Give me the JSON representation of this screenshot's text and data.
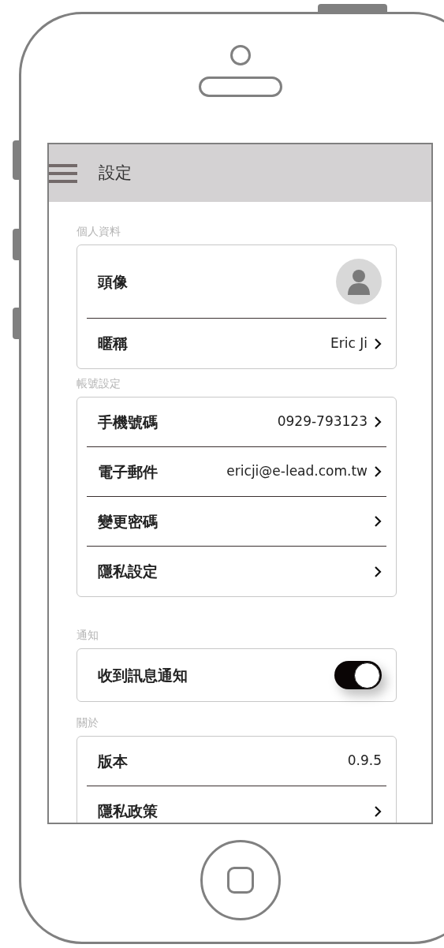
{
  "header": {
    "title": "設定"
  },
  "sections": [
    {
      "label": "個人資料",
      "rows": [
        {
          "kind": "avatar",
          "label": "頭像"
        },
        {
          "kind": "link",
          "label": "暱稱",
          "value": "Eric Ji"
        }
      ]
    },
    {
      "label": "帳號設定",
      "rows": [
        {
          "kind": "link",
          "label": "手機號碼",
          "value": "0929-793123"
        },
        {
          "kind": "link",
          "label": "電子郵件",
          "value": "ericji@e-lead.com.tw"
        },
        {
          "kind": "link",
          "label": "變更密碼"
        },
        {
          "kind": "link",
          "label": "隱私設定"
        }
      ]
    },
    {
      "label": "通知",
      "rows": [
        {
          "kind": "toggle",
          "label": "收到訊息通知",
          "on": true
        }
      ]
    },
    {
      "label": "關於",
      "rows": [
        {
          "kind": "info",
          "label": "版本",
          "value": "0.9.5"
        },
        {
          "kind": "link",
          "label": "隱私政策"
        }
      ]
    }
  ]
}
